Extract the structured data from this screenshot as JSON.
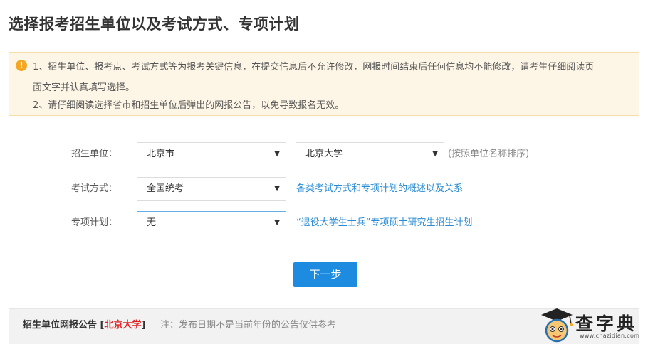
{
  "page": {
    "title": "选择报考招生单位以及考试方式、专项计划"
  },
  "notice": {
    "icon": "!",
    "line1": "1、招生单位、报考点、考试方式等为报考关键信息，在提交信息后不允许修改，网报时间结束后任何信息均不能修改，请考生仔细阅读页",
    "line2": "面文字并认真填写选择。",
    "line3": "2、请仔细阅读选择省市和招生单位后弹出的网报公告，以免导致报名无效。"
  },
  "form": {
    "institution": {
      "label": "招生单位：",
      "province": "北京市",
      "school": "北京大学",
      "hint": "(按照单位名称排序)"
    },
    "exam_mode": {
      "label": "考试方式：",
      "value": "全国统考",
      "link": "各类考试方式和专项计划的概述以及关系"
    },
    "special_plan": {
      "label": "专项计划：",
      "value": "无",
      "link": "“退役大学生士兵”专项硕士研究生招生计划"
    },
    "caret": "▼",
    "next_button": "下一步"
  },
  "bulletin": {
    "title": "招生单位网报公告",
    "bracket_open": "[",
    "school": "北京大学",
    "bracket_close": "]",
    "note": "注：发布日期不是当前年份的公告仅供参考"
  },
  "watermark": {
    "text": "查字典",
    "url": "www.chazidian.com"
  },
  "colors": {
    "accent": "#1d8ce0",
    "link": "#2a8bd4",
    "warning": "#f5a623",
    "notice_bg": "#fdf6e6",
    "highlight": "#e02020"
  }
}
